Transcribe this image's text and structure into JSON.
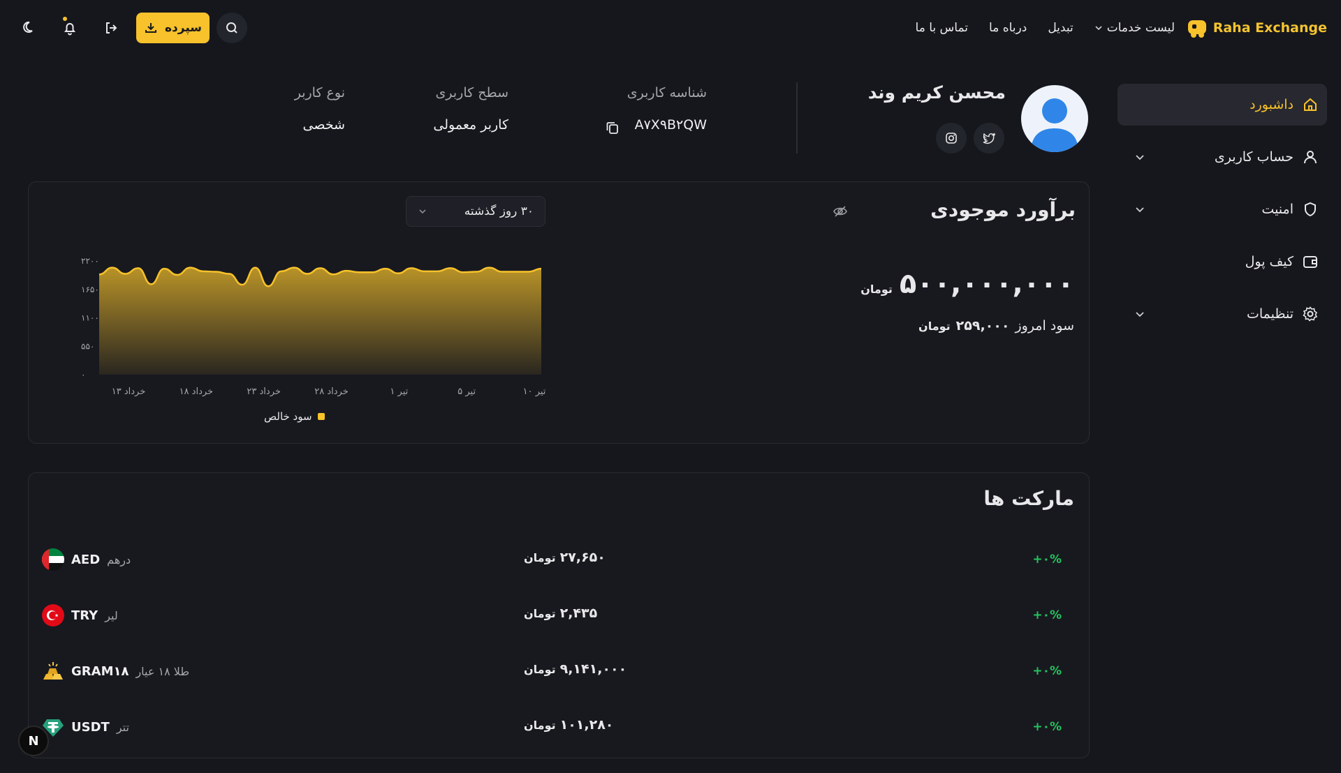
{
  "header": {
    "brand": "Raha Exchange",
    "nav": [
      {
        "label": "لیست خدمات",
        "has_dropdown": true
      },
      {
        "label": "تبدیل"
      },
      {
        "label": "درباه ما"
      },
      {
        "label": "تماس با ما"
      }
    ],
    "deposit_label": "سپرده",
    "icons": [
      "search-icon",
      "download-icon",
      "logout-icon",
      "bell-icon",
      "moon-icon"
    ]
  },
  "sidebar": {
    "items": [
      {
        "label": "داشبورد",
        "icon": "home-icon",
        "active": true
      },
      {
        "label": "حساب کاربری",
        "icon": "user-icon",
        "has_dropdown": true
      },
      {
        "label": "امنیت",
        "icon": "shield-icon",
        "has_dropdown": true
      },
      {
        "label": "کیف پول",
        "icon": "wallet-icon"
      },
      {
        "label": "تنظیمات",
        "icon": "gear-icon",
        "has_dropdown": true
      }
    ]
  },
  "profile": {
    "name": "محسن کریم وند",
    "user_id_label": "شناسه کاربری",
    "user_id": "A۷X۹B۲QW",
    "level_label": "سطح کاربری",
    "level": "کاربر معمولی",
    "type_label": "نوع کاربر",
    "type": "شخصی"
  },
  "balance": {
    "title": "برآورد موجودی",
    "period": "۳۰ روز گذشته",
    "amount": "۵۰۰,۰۰۰,۰۰۰",
    "unit": "تومان",
    "profit_label": "سود امروز",
    "profit_value": "۲۵۹,۰۰۰",
    "profit_unit": "تومان"
  },
  "chart_data": {
    "type": "area",
    "title": "",
    "xlabel": "",
    "ylabel": "",
    "ylim": [
      0,
      2200
    ],
    "y_ticks": [
      "۰",
      "۵۵۰",
      "۱۱۰۰",
      "۱۶۵۰",
      "۲۲۰۰"
    ],
    "x_ticks": [
      "۱۳ خرداد",
      "۱۸ خرداد",
      "۲۳ خرداد",
      "۲۸ خرداد",
      "۱ تیر",
      "۵ تیر",
      "۱۰ تیر"
    ],
    "grid": false,
    "legend_position": "bottom",
    "color": "#f7c22b",
    "series": [
      {
        "name": "سود خالص",
        "values": [
          1940,
          2070,
          1950,
          2060,
          1750,
          2050,
          1930,
          2070,
          2000,
          1990,
          1950,
          1740,
          2070,
          1710,
          2000,
          2070,
          1950,
          2060,
          1940,
          2010,
          1980,
          1980,
          2050,
          1960,
          2060,
          2000,
          2000,
          2060,
          1980,
          1990,
          2070,
          1990,
          1990,
          1990,
          2050
        ]
      }
    ]
  },
  "markets": {
    "title": "مارکت ها",
    "rows": [
      {
        "symbol": "AED",
        "name": "درهم",
        "price": "۲۷,۶۵۰",
        "unit": "تومان",
        "change": "+۰%",
        "icon": "uae-flag-icon"
      },
      {
        "symbol": "TRY",
        "name": "لیر",
        "price": "۲,۴۳۵",
        "unit": "تومان",
        "change": "+۰%",
        "icon": "turkey-flag-icon"
      },
      {
        "symbol": "GRAM۱۸",
        "name": "طلا ۱۸ عیار",
        "price": "۹,۱۴۱,۰۰۰",
        "unit": "تومان",
        "change": "+۰%",
        "icon": "gold-bar-icon"
      },
      {
        "symbol": "USDT",
        "name": "تتر",
        "price": "۱۰۱,۲۸۰",
        "unit": "تومان",
        "change": "+۰%",
        "icon": "tether-icon"
      }
    ]
  },
  "fab_label": "N"
}
